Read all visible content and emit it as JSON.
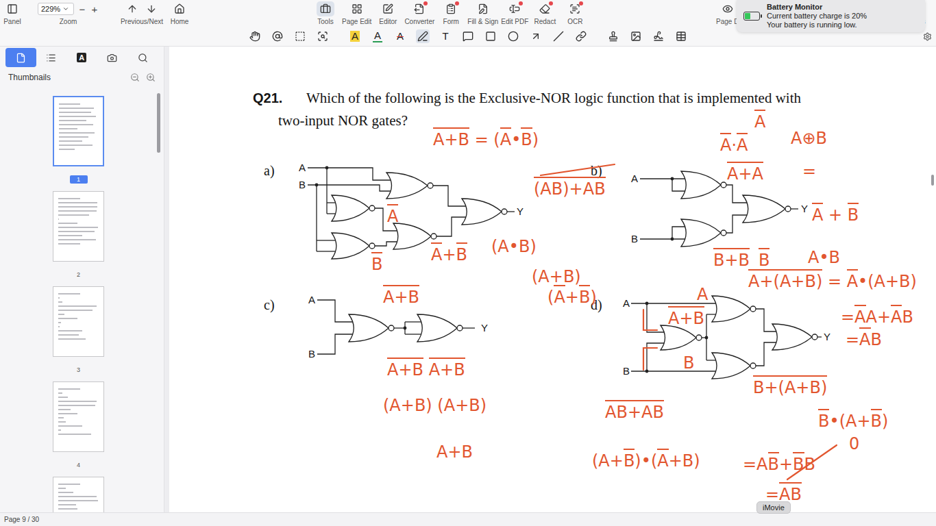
{
  "toolbar": {
    "panel": {
      "label": "Panel"
    },
    "zoom": {
      "value": "229%",
      "label": "Zoom",
      "minus": "−",
      "plus": "+"
    },
    "nav": [
      {
        "label": "Previous/Next"
      },
      {
        "label": "Home"
      }
    ],
    "tools": [
      {
        "label": "Tools",
        "selected": true,
        "badge": false
      },
      {
        "label": "Page Edit",
        "selected": false,
        "badge": false
      },
      {
        "label": "Editor",
        "selected": false,
        "badge": false
      },
      {
        "label": "Converter",
        "selected": false,
        "badge": true
      },
      {
        "label": "Form",
        "selected": false,
        "badge": true
      },
      {
        "label": "Fill & Sign",
        "selected": false,
        "badge": false
      },
      {
        "label": "Edit PDF",
        "selected": false,
        "badge": true
      },
      {
        "label": "Redact",
        "selected": false,
        "badge": true
      },
      {
        "label": "OCR",
        "selected": false,
        "badge": true
      }
    ],
    "right_labels": [
      "Page D",
      "s"
    ]
  },
  "annotation_bar": {
    "groups": [
      [
        {
          "kind": "icon",
          "selected": false
        },
        {
          "kind": "icon",
          "selected": false
        },
        {
          "kind": "icon",
          "selected": false
        },
        {
          "kind": "icon",
          "selected": false
        }
      ],
      [
        {
          "kind": "glyph",
          "text": "A",
          "mark": "highlight",
          "selected": false
        },
        {
          "kind": "glyph",
          "text": "A",
          "mark": "underline",
          "selected": false
        },
        {
          "kind": "glyph",
          "text": "A",
          "mark": "strike",
          "selected": false
        },
        {
          "kind": "icon",
          "selected": true
        },
        {
          "kind": "glyph",
          "text": "T",
          "mark": "plain",
          "selected": false
        },
        {
          "kind": "icon",
          "selected": false
        },
        {
          "kind": "icon",
          "selected": false
        },
        {
          "kind": "icon",
          "selected": false
        },
        {
          "kind": "icon",
          "selected": false
        },
        {
          "kind": "icon",
          "selected": false
        },
        {
          "kind": "icon",
          "selected": false
        }
      ],
      [
        {
          "kind": "icon",
          "selected": false
        },
        {
          "kind": "icon",
          "selected": false
        },
        {
          "kind": "icon",
          "selected": false
        },
        {
          "kind": "icon",
          "selected": false
        }
      ]
    ]
  },
  "notification": {
    "title": "Battery Monitor",
    "lines": [
      "Current battery charge is 20%",
      "Your battery is running low."
    ],
    "level": 0.4
  },
  "sidebar": {
    "tabs": [
      {
        "kind": "icon",
        "selected": true
      },
      {
        "kind": "icon",
        "selected": false
      },
      {
        "kind": "glyph",
        "text": "A",
        "selected": false
      },
      {
        "kind": "icon",
        "selected": false
      },
      {
        "kind": "icon",
        "selected": false
      }
    ],
    "header": "Thumbnails",
    "pages": [
      {
        "label": "1",
        "selected": true
      },
      {
        "label": "2",
        "selected": false
      },
      {
        "label": "3",
        "selected": false
      },
      {
        "label": "4",
        "selected": false
      },
      {
        "label": "",
        "selected": false
      }
    ]
  },
  "document": {
    "question": {
      "number": "Q21.",
      "lines": [
        "Which of the following is the Exclusive-NOR logic function that is implemented with",
        "two-input NOR gates?"
      ]
    },
    "options": [
      {
        "label": "a)",
        "inputs": [
          "A",
          "B"
        ],
        "output": "Y"
      },
      {
        "label": "b)",
        "inputs": [
          "A",
          "B"
        ],
        "output": "Y"
      },
      {
        "label": "c)",
        "inputs": [
          "A",
          "B"
        ],
        "output": "Y"
      },
      {
        "label": "d)",
        "inputs": [
          "A",
          "B"
        ],
        "output": "Y"
      }
    ],
    "annotations": [
      {
        "parts": [
          {
            "t": "A+B",
            "bar": true
          },
          {
            "t": " = (",
            "bar": false
          },
          {
            "t": "A",
            "bar": true
          },
          {
            "t": "•",
            "bar": false
          },
          {
            "t": "B",
            "bar": true
          },
          {
            "t": ")",
            "bar": false
          }
        ]
      },
      {
        "parts": [
          {
            "t": "A",
            "bar": true
          }
        ]
      },
      {
        "parts": [
          {
            "t": "B",
            "bar": true
          }
        ]
      },
      {
        "parts": [
          {
            "t": "A",
            "bar": true
          },
          {
            "t": "+",
            "bar": false
          },
          {
            "t": "B",
            "bar": true
          }
        ]
      },
      {
        "parts": [
          {
            "t": "(A•B)",
            "bar": false
          }
        ]
      },
      {
        "parts": [
          {
            "t": "(AB)+AB",
            "bar": true
          }
        ]
      },
      {
        "parts": [
          {
            "t": "(A+B)",
            "bar": false
          }
        ]
      },
      {
        "parts": [
          {
            "t": "(",
            "bar": false
          },
          {
            "t": "A",
            "bar": true
          },
          {
            "t": "+",
            "bar": false
          },
          {
            "t": "B",
            "bar": true
          },
          {
            "t": ")",
            "bar": false
          }
        ]
      },
      {
        "parts": [
          {
            "t": "A",
            "bar": true
          }
        ]
      },
      {
        "parts": [
          {
            "t": "A",
            "bar": true
          },
          {
            "t": "·",
            "bar": false
          },
          {
            "t": "A",
            "bar": true
          }
        ]
      },
      {
        "parts": [
          {
            "t": "A+A",
            "bar": true
          }
        ]
      },
      {
        "parts": [
          {
            "t": "A⊕B",
            "bar": false
          }
        ]
      },
      {
        "parts": [
          {
            "t": "=",
            "bar": false
          }
        ]
      },
      {
        "parts": [
          {
            "t": "B+B",
            "bar": true
          }
        ]
      },
      {
        "parts": [
          {
            "t": "B",
            "bar": true
          }
        ]
      },
      {
        "parts": [
          {
            "t": "A",
            "bar": true
          },
          {
            "t": " + ",
            "bar": false
          },
          {
            "t": "B",
            "bar": true
          }
        ]
      },
      {
        "parts": [
          {
            "t": "A•B",
            "bar": false
          }
        ]
      },
      {
        "parts": [
          {
            "t": "A+B",
            "bar": true
          }
        ]
      },
      {
        "parts": [
          {
            "t": "A+B",
            "bar": true
          },
          {
            "t": " ",
            "bar": false
          },
          {
            "t": "A+B",
            "bar": true
          }
        ]
      },
      {
        "parts": [
          {
            "t": "(A+B) (A+B)",
            "bar": false
          }
        ]
      },
      {
        "parts": [
          {
            "t": "A+B",
            "bar": false
          }
        ]
      },
      {
        "parts": [
          {
            "t": "A",
            "bar": false
          }
        ]
      },
      {
        "parts": [
          {
            "t": "A+B",
            "bar": true
          }
        ]
      },
      {
        "parts": [
          {
            "t": "B",
            "bar": false
          }
        ]
      },
      {
        "parts": [
          {
            "t": "A+(A+B)",
            "bar": true
          },
          {
            "t": " = ",
            "bar": false
          },
          {
            "t": "A",
            "bar": true
          },
          {
            "t": "•(A+B)",
            "bar": false
          }
        ]
      },
      {
        "parts": [
          {
            "t": "=",
            "bar": false
          },
          {
            "t": "A",
            "bar": true
          },
          {
            "t": "A+",
            "bar": false
          },
          {
            "t": "A",
            "bar": true
          },
          {
            "t": "B",
            "bar": false
          }
        ]
      },
      {
        "parts": [
          {
            "t": "=",
            "bar": false
          },
          {
            "t": "A",
            "bar": true
          },
          {
            "t": "B",
            "bar": false
          }
        ]
      },
      {
        "parts": [
          {
            "t": "B+(A+B)",
            "bar": true
          }
        ]
      },
      {
        "parts": [
          {
            "t": "AB+AB",
            "bar": true
          }
        ]
      },
      {
        "parts": [
          {
            "t": "(A+",
            "bar": false
          },
          {
            "t": "B",
            "bar": true
          },
          {
            "t": ")•(",
            "bar": false
          },
          {
            "t": "A",
            "bar": true
          },
          {
            "t": "+B)",
            "bar": false
          }
        ]
      },
      {
        "parts": [
          {
            "t": "B",
            "bar": true
          },
          {
            "t": "•(A+",
            "bar": false
          },
          {
            "t": "B",
            "bar": true
          },
          {
            "t": ")",
            "bar": false
          }
        ]
      },
      {
        "parts": [
          {
            "t": "=A",
            "bar": false
          },
          {
            "t": "B",
            "bar": true
          },
          {
            "t": "+",
            "bar": false
          },
          {
            "t": "B",
            "bar": true
          },
          {
            "t": "B",
            "bar": false
          }
        ]
      },
      {
        "parts": [
          {
            "t": "0",
            "bar": false
          }
        ]
      },
      {
        "parts": [
          {
            "t": "=",
            "bar": false
          },
          {
            "t": "AB",
            "bar": true
          }
        ]
      }
    ]
  },
  "status_bar": {
    "page": "Page 9 / 30"
  },
  "tooltip": {
    "text": "iMovie"
  }
}
